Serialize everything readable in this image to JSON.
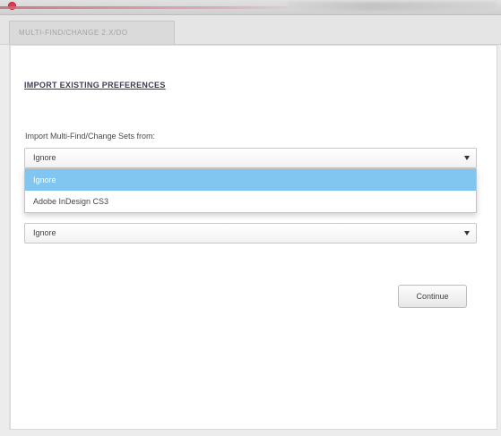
{
  "window": {
    "tab_label": "MULTI-FIND/CHANGE 2.x/DO"
  },
  "import_preferences": {
    "section_title": "IMPORT EXISTING PREFERENCES",
    "sets_label": "Import Multi-Find/Change Sets from:",
    "sets_select": {
      "selected": "Ignore",
      "options": [
        "Ignore",
        "Adobe InDesign CS3"
      ]
    },
    "second_select": {
      "selected": "Ignore"
    }
  },
  "actions": {
    "continue_label": "Continue"
  },
  "colors": {
    "highlight": "#80c6f0",
    "close_button": "#e5374d",
    "section_title": "#3e3e52"
  },
  "icons": {
    "close": "close-icon",
    "dropdown": "chevron-down-icon"
  }
}
